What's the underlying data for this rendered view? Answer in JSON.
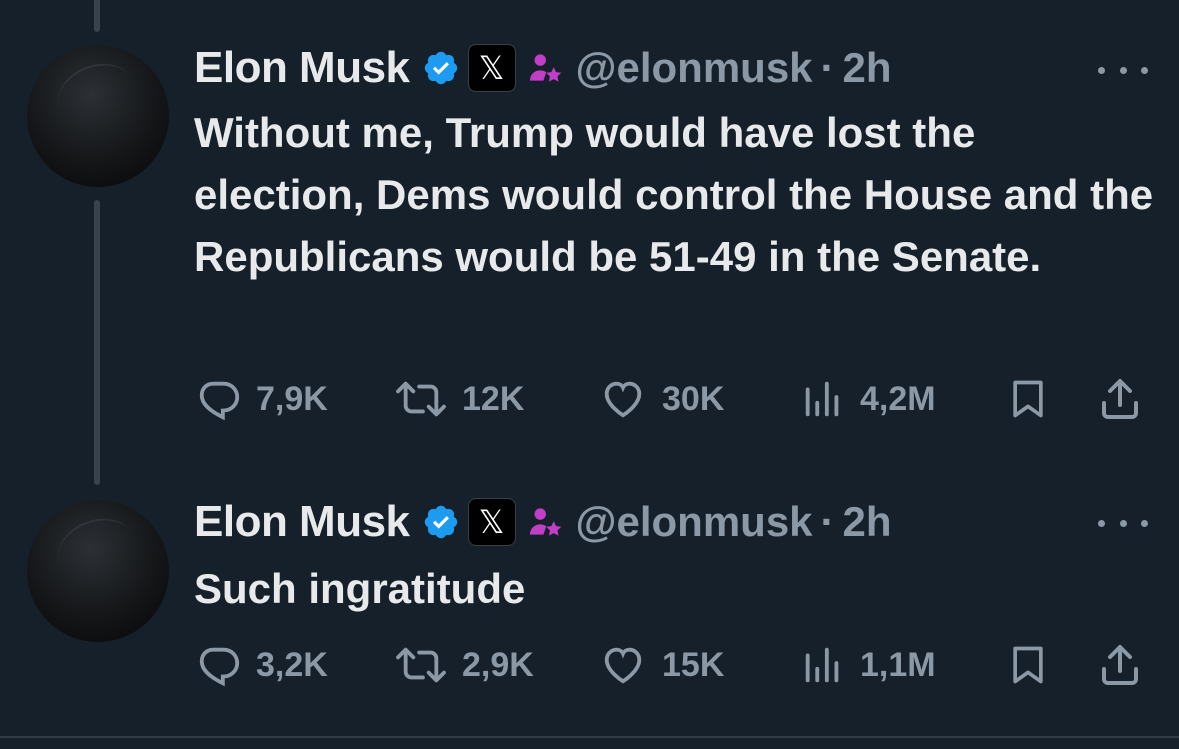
{
  "colors": {
    "background": "#15202b",
    "text_primary": "#e7e9ea",
    "text_secondary": "#8b98a5",
    "verified_blue": "#1d9bf0",
    "affiliate_magenta": "#c13ec7",
    "thread_line": "#38444d"
  },
  "tweets": [
    {
      "author_name": "Elon Musk",
      "handle": "@elonmusk",
      "separator": "·",
      "time": "2h",
      "badges": [
        "verified-badge-icon",
        "x-logo-badge",
        "affiliate-icon"
      ],
      "x_badge_glyph": "𝕏",
      "text": "Without me, Trump would have lost the election, Dems would control the House and the Republicans would be 51-49 in the Senate.",
      "stats": {
        "replies": "7,9K",
        "reposts": "12K",
        "likes": "30K",
        "views": "4,2M"
      },
      "icons": [
        "reply-icon",
        "repost-icon",
        "like-icon",
        "views-icon",
        "bookmark-icon",
        "share-icon"
      ]
    },
    {
      "author_name": "Elon Musk",
      "handle": "@elonmusk",
      "separator": "·",
      "time": "2h",
      "badges": [
        "verified-badge-icon",
        "x-logo-badge",
        "affiliate-icon"
      ],
      "x_badge_glyph": "𝕏",
      "text": "Such ingratitude",
      "stats": {
        "replies": "3,2K",
        "reposts": "2,9K",
        "likes": "15K",
        "views": "1,1M"
      },
      "icons": [
        "reply-icon",
        "repost-icon",
        "like-icon",
        "views-icon",
        "bookmark-icon",
        "share-icon"
      ]
    }
  ]
}
